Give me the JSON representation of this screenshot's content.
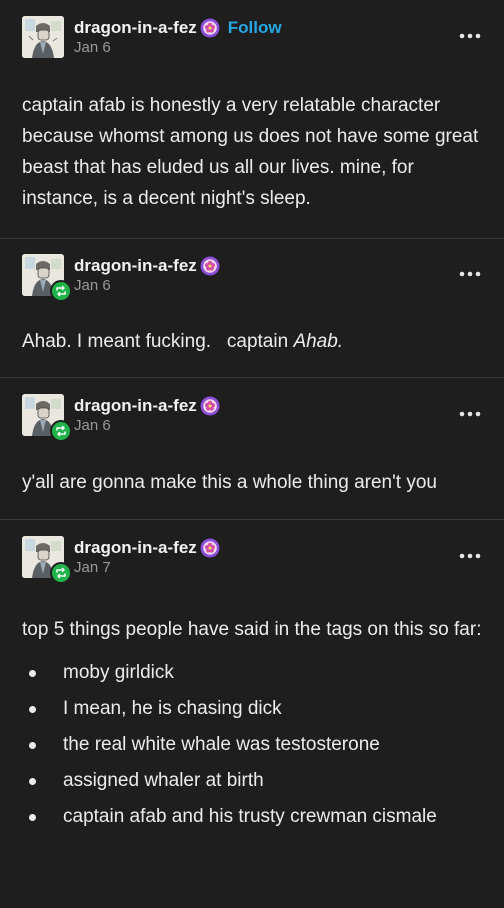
{
  "posts": [
    {
      "blog_name": "dragon-in-a-fez",
      "date": "Jan 6",
      "follow_label": "Follow",
      "reblog": false,
      "body": "captain afab is honestly a very relatable character because whomst among us does not have some great beast that has eluded us all our lives. mine, for instance, is a decent night's sleep."
    },
    {
      "blog_name": "dragon-in-a-fez",
      "date": "Jan 6",
      "reblog": true,
      "body_part1": "Ahab. I meant fucking.   captain ",
      "body_italic": "Ahab."
    },
    {
      "blog_name": "dragon-in-a-fez",
      "date": "Jan 6",
      "reblog": true,
      "body": "y'all are gonna make this a whole thing aren't you"
    },
    {
      "blog_name": "dragon-in-a-fez",
      "date": "Jan 7",
      "reblog": true,
      "body": "top 5 things people have said in the tags on this so far:",
      "list": [
        "moby girldick",
        "I mean, he is chasing dick",
        "the real white whale was testosterone",
        "assigned whaler at birth",
        "captain afab and his trusty crewman cismale"
      ]
    }
  ],
  "colors": {
    "background": "#1e1e1e",
    "text": "#ececec",
    "follow": "#25a7e4",
    "reblog_badge": "#1fb34a",
    "separator": "#3a3a3a"
  },
  "icons": {
    "avatar": "dragon-in-a-fez-avatar",
    "badge": "purple-flower-badge-icon",
    "reblog": "reblog-icon",
    "more": "more-options-icon"
  }
}
